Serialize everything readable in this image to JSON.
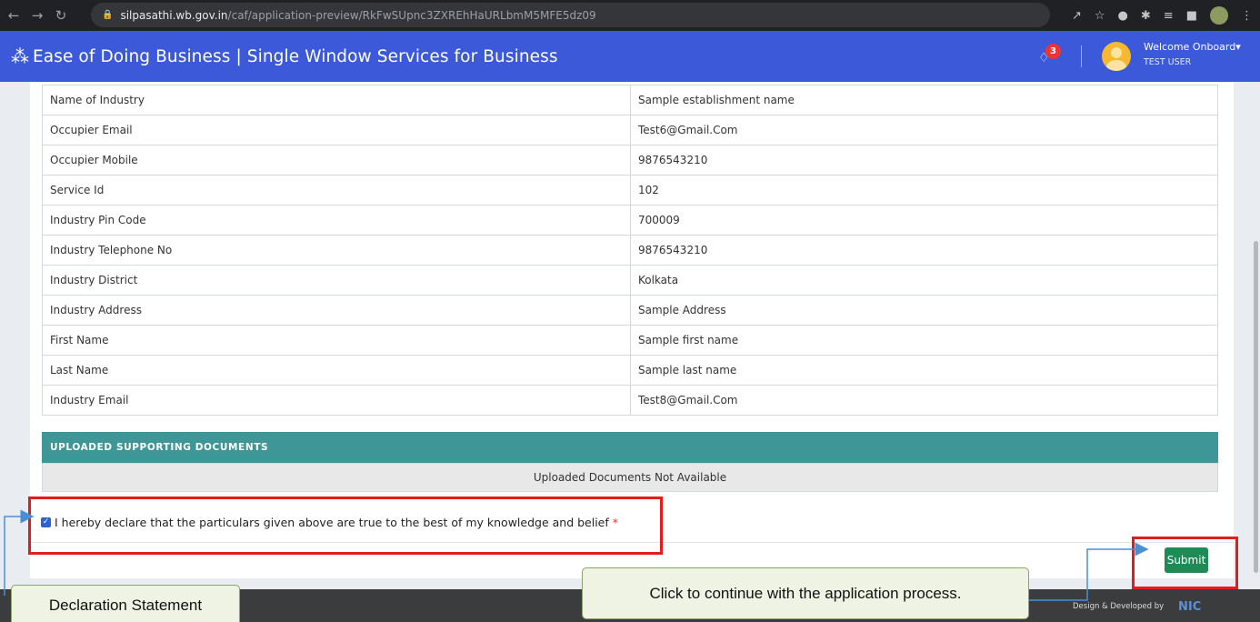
{
  "browser": {
    "url_host": "silpasathi.wb.gov.in",
    "url_path": "/caf/application-preview/RkFwSUpnc3ZXREhHaURLbmM5MFE5dz09"
  },
  "header": {
    "title": "Ease of Doing Business | Single Window Services for Business",
    "notification_count": "3",
    "welcome": "Welcome Onboard",
    "user_name": "TEST USER"
  },
  "details": [
    {
      "label": "Name of Industry",
      "value": "Sample establishment name"
    },
    {
      "label": "Occupier Email",
      "value": "Test6@Gmail.Com"
    },
    {
      "label": "Occupier Mobile",
      "value": "9876543210"
    },
    {
      "label": "Service Id",
      "value": "102"
    },
    {
      "label": "Industry Pin Code",
      "value": "700009"
    },
    {
      "label": "Industry Telephone No",
      "value": "9876543210"
    },
    {
      "label": "Industry District",
      "value": "Kolkata"
    },
    {
      "label": "Industry Address",
      "value": "Sample Address"
    },
    {
      "label": "First Name",
      "value": "Sample first name"
    },
    {
      "label": "Last Name",
      "value": "Sample last name"
    },
    {
      "label": "Industry Email",
      "value": "Test8@Gmail.Com"
    }
  ],
  "documents": {
    "heading": "UPLOADED SUPPORTING DOCUMENTS",
    "empty_text": "Uploaded Documents Not Available"
  },
  "declaration": {
    "text": "I hereby declare that the particulars given above are true to the best of my knowledge and belief",
    "required_mark": "*",
    "checked": true
  },
  "submit_label": "Submit",
  "footer": {
    "text": "Design & Developed by",
    "logo": "NIC"
  },
  "annotations": {
    "submit_callout": "Click to continue with the application process.",
    "declaration_callout": "Declaration Statement"
  },
  "colors": {
    "header_bg": "#3b59d9",
    "docs_header_bg": "#3f9696",
    "submit_bg": "#1e8a55",
    "highlight": "#e31c1c",
    "badge": "#e33333"
  }
}
